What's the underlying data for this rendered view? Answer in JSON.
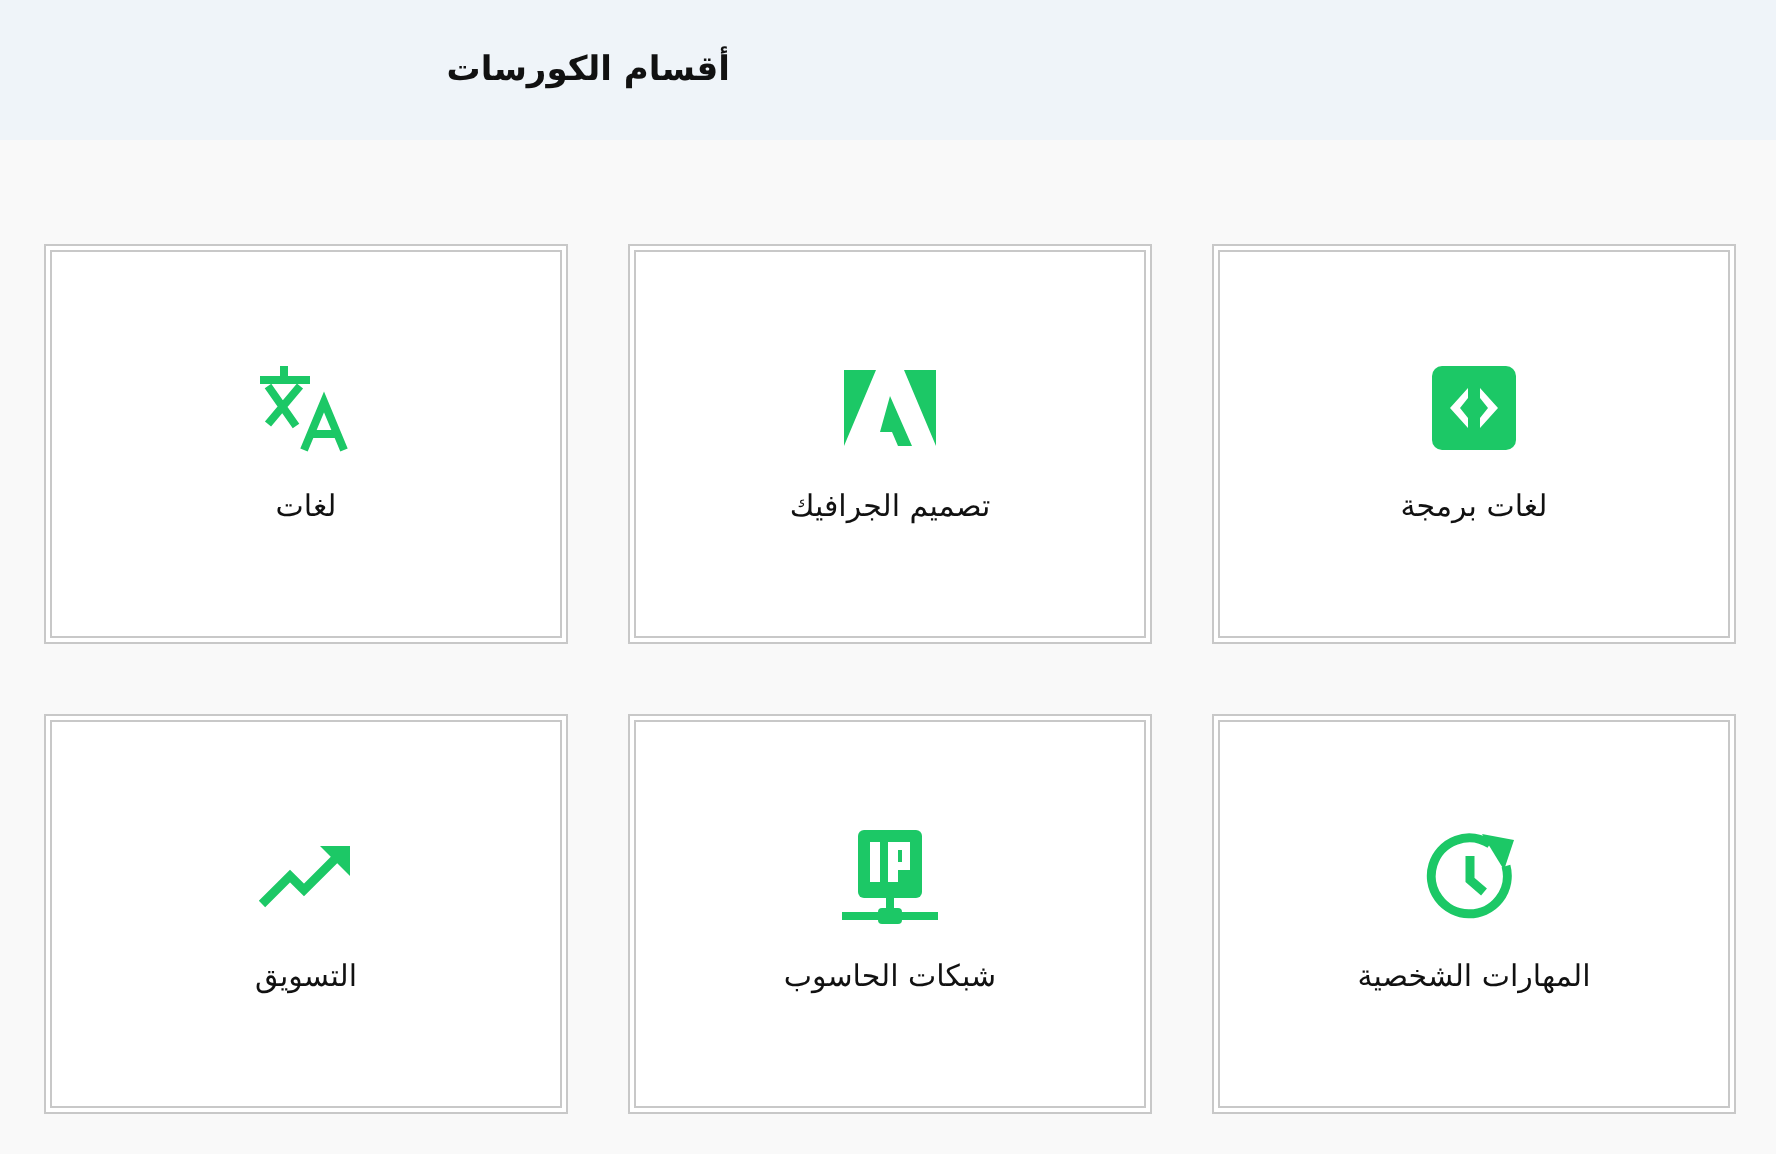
{
  "header": {
    "title": "أقسام الكورسات"
  },
  "categories": [
    {
      "label": "لغات برمجة"
    },
    {
      "label": "تصميم الجرافيك"
    },
    {
      "label": "لغات"
    },
    {
      "label": "المهارات الشخصية"
    },
    {
      "label": "شبكات الحاسوب"
    },
    {
      "label": "التسويق"
    }
  ]
}
